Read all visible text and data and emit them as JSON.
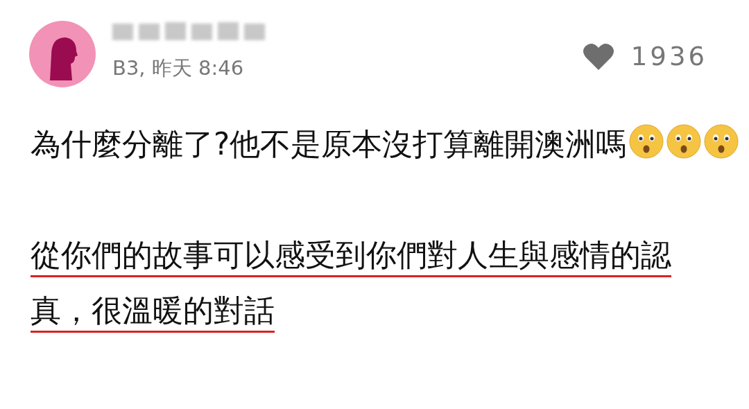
{
  "comment": {
    "meta": "B3, 昨天 8:46",
    "likes": "1936",
    "liked": false,
    "paragraphs": [
      {
        "text": "為什麼分離了?他不是原本沒打算離開澳洲嗎",
        "underlined": false,
        "emojis": [
          {
            "kind": "hushed"
          },
          {
            "kind": "hushed"
          },
          {
            "kind": "hushed"
          }
        ]
      },
      {
        "text": "從你們的故事可以感受到你們對人生與感情的認真，很溫暖的對話",
        "underlined": true
      }
    ]
  }
}
